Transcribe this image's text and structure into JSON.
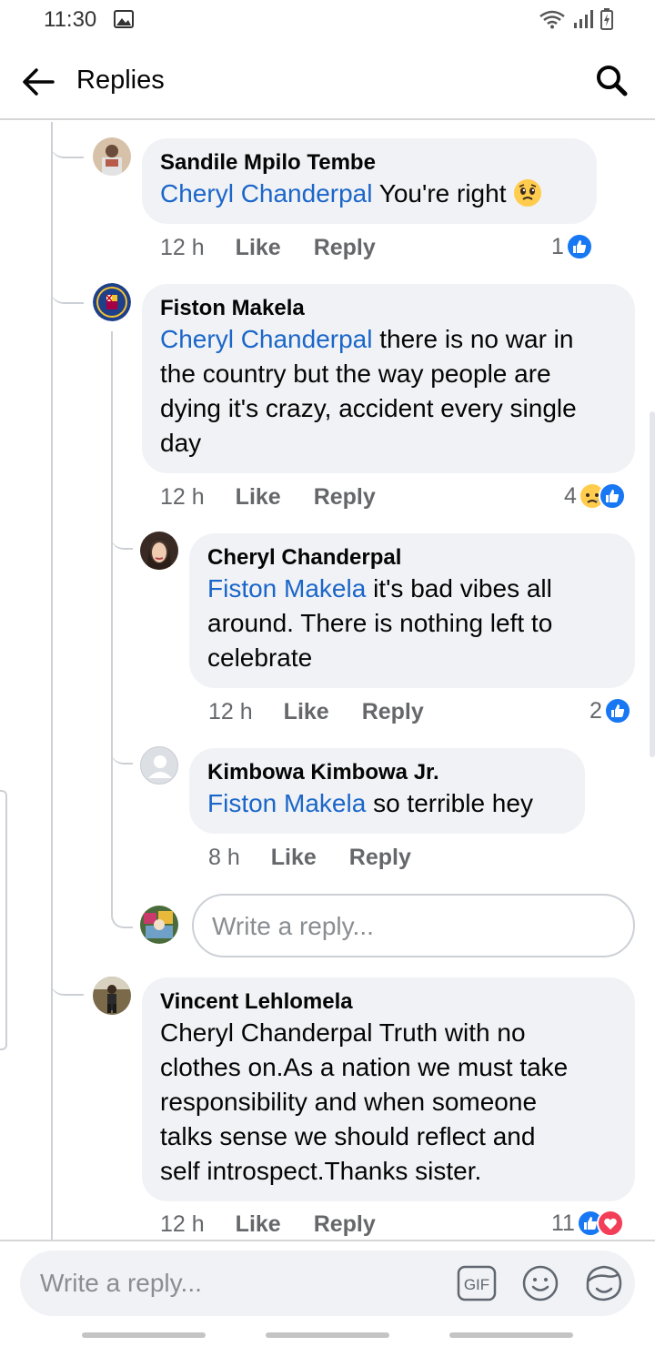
{
  "status_bar": {
    "time": "11:30"
  },
  "header": {
    "title": "Replies"
  },
  "comments": [
    {
      "author": "Sandile Mpilo Tembe",
      "mention": "Cheryl Chanderpal",
      "text": " You're right",
      "time": "12 h",
      "like": "Like",
      "reply": "Reply",
      "reaction_count": "1"
    },
    {
      "author": "Fiston Makela",
      "mention": "Cheryl Chanderpal",
      "text_lines": [
        " there is no war in",
        "the country but the way people are",
        "dying it's crazy, accident every single",
        "day"
      ],
      "time": "12 h",
      "like": "Like",
      "reply": "Reply",
      "reaction_count": "4"
    },
    {
      "author": "Cheryl Chanderpal",
      "mention": "Fiston Makela",
      "text_lines": [
        " it's bad vibes all",
        "around. There is nothing left to",
        "celebrate"
      ],
      "time": "12 h",
      "like": "Like",
      "reply": "Reply",
      "reaction_count": "2"
    },
    {
      "author": "Kimbowa Kimbowa Jr.",
      "mention": "Fiston Makela",
      "text": " so terrible hey",
      "time": "8 h",
      "like": "Like",
      "reply": "Reply"
    },
    {
      "author": "Vincent Lehlomela",
      "text_lines": [
        "Cheryl Chanderpal Truth with no",
        "clothes on.As a nation we must take",
        "responsibility and when someone",
        "talks sense we should reflect and",
        "self introspect.Thanks sister."
      ],
      "time": "12 h",
      "like": "Like",
      "reply": "Reply",
      "reaction_count": "11"
    }
  ],
  "inline_reply": {
    "placeholder": "Write a reply..."
  },
  "composer": {
    "placeholder": "Write a reply...",
    "gif_label": "GIF"
  },
  "colors": {
    "mention": "#1b66c9",
    "like_blue": "#1877f2",
    "love_red": "#f33e58",
    "bubble": "#f0f2f5"
  }
}
